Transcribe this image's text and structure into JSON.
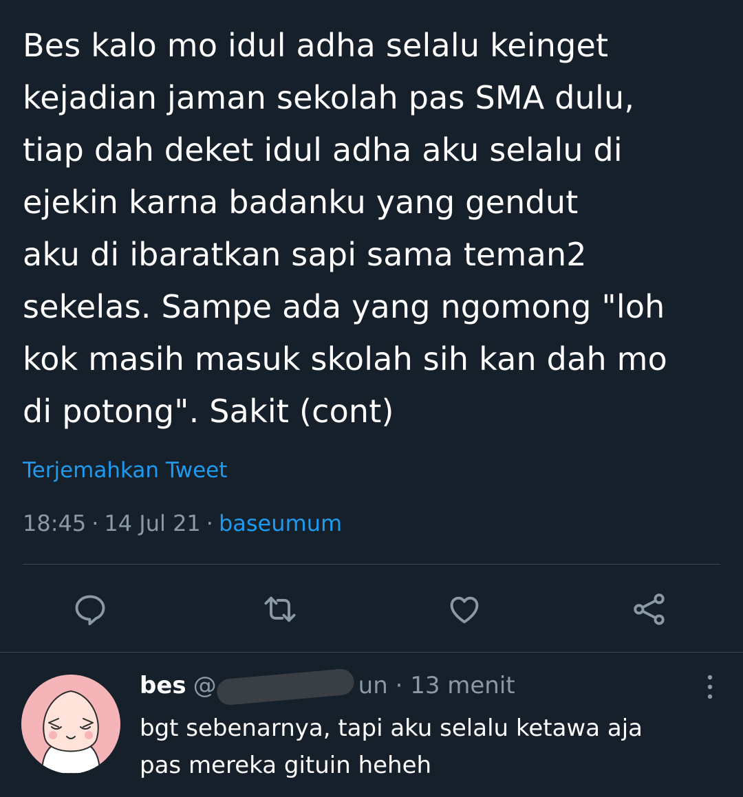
{
  "tweet": {
    "text": "Bes kalo mo idul adha selalu keinget\nkejadian jaman sekolah pas SMA dulu,\ntiap dah deket idul adha aku selalu di\nejekin karna badanku yang gendut\naku di ibaratkan sapi sama teman2\nsekelas. Sampe ada yang ngomong \"loh\nkok masih masuk skolah sih kan dah mo\ndi potong\". Sakit (cont)",
    "translate_label": "Terjemahkan Tweet",
    "time": "18:45",
    "date": "14 Jul 21",
    "source": "baseumum",
    "separator": "·"
  },
  "actions": {
    "reply_icon": "reply-icon",
    "retweet_icon": "retweet-icon",
    "like_icon": "heart-icon",
    "share_icon": "share-icon"
  },
  "reply": {
    "name": "bes",
    "handle_prefix": "@",
    "handle_tail": "un",
    "separator": "·",
    "time_ago": "13 menit",
    "text": "bgt sebenarnya, tapi aku selalu ketawa aja\npas mereka gituin heheh",
    "avatar_icon": "peach-avatar",
    "more_icon": "more-vertical-icon"
  },
  "colors": {
    "background": "#15202b",
    "text": "#ffffff",
    "secondary": "#8b98a5",
    "accent": "#1d9bf0",
    "divider": "#38444d"
  }
}
